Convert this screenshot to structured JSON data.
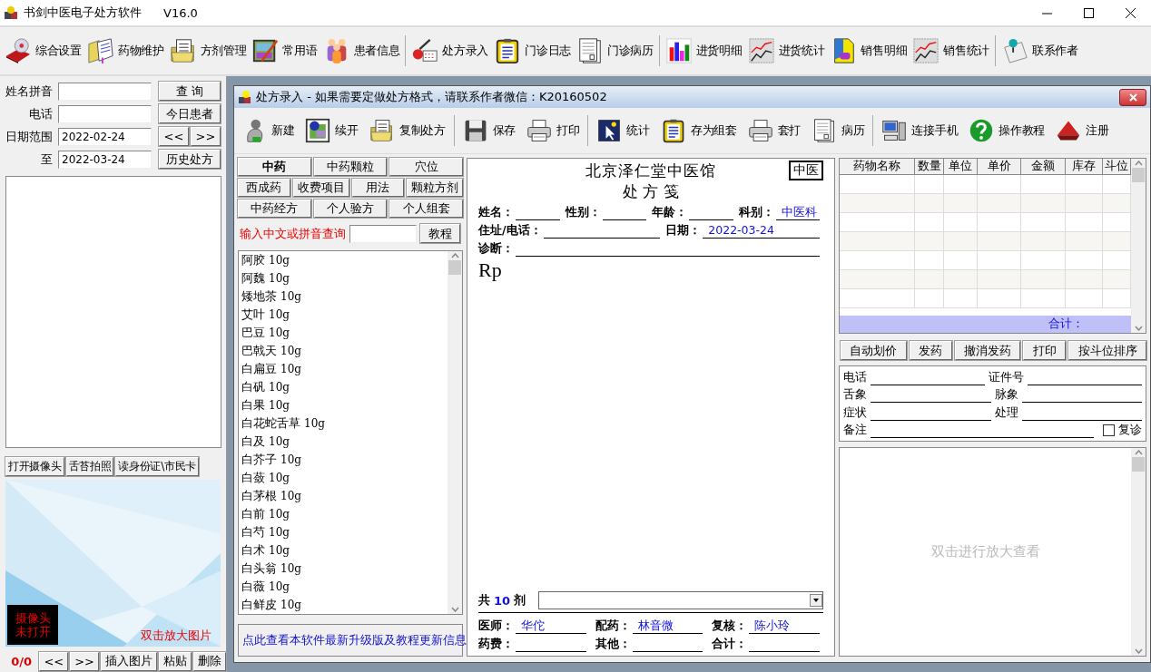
{
  "app": {
    "title": "书剑中医电子处方软件",
    "version": "V16.0"
  },
  "toolbar": {
    "groups": [
      [
        "综合设置",
        "药物维护",
        "方剂管理",
        "常用语",
        "患者信息"
      ],
      [
        "处方录入",
        "门诊日志",
        "门诊病历"
      ],
      [
        "进货明细",
        "进货统计",
        "销售明细",
        "销售统计"
      ],
      [
        "联系作者"
      ]
    ]
  },
  "patient_search": {
    "fields": [
      {
        "label": "姓名拼音",
        "buttons": [
          "查 询"
        ]
      },
      {
        "label": "电话",
        "buttons": [
          "今日患者"
        ]
      },
      {
        "label": "日期范围",
        "value": "2022-02-24",
        "buttons": [
          "<<",
          ">>"
        ]
      },
      {
        "label": "至",
        "value": "2022-03-24",
        "buttons": [
          "历史处方"
        ]
      }
    ]
  },
  "camera": {
    "buttons": [
      "打开摄像头",
      "舌苔拍照",
      "读身份证\\市民卡"
    ],
    "status": [
      "摄像头",
      "未打开"
    ],
    "hint": "双击放大图片"
  },
  "photo_nav": {
    "counter": "0/0",
    "buttons": [
      "<<",
      ">>",
      "插入图片",
      "粘贴",
      "删除"
    ]
  },
  "editor": {
    "title": "处方录入 - 如果需要定做处方格式，请联系作者微信：K20160502",
    "toolbar": {
      "groups": [
        [
          "新建",
          "续开",
          "复制处方"
        ],
        [
          "保存",
          "打印"
        ],
        [
          "统计",
          "存为组套",
          "套打",
          "病历"
        ],
        [
          "连接手机",
          "操作教程",
          "注册"
        ]
      ]
    },
    "categories": [
      [
        {
          "label": "中药",
          "selected": true
        },
        {
          "label": "中药颗粒",
          "selected": false
        },
        {
          "label": "穴位",
          "selected": false
        }
      ],
      [
        {
          "label": "西成药",
          "selected": false
        },
        {
          "label": "收费项目",
          "selected": false
        },
        {
          "label": "用法",
          "selected": false
        },
        {
          "label": "颗粒方剂",
          "selected": false
        }
      ],
      [
        {
          "label": "中药经方",
          "selected": false
        },
        {
          "label": "个人验方",
          "selected": false
        },
        {
          "label": "个人组套",
          "selected": false
        }
      ]
    ],
    "search": {
      "label": "输入中文或拼音查询",
      "button": "教程"
    },
    "medicines": [
      {
        "name": "阿胶",
        "dose": "10g"
      },
      {
        "name": "阿魏",
        "dose": "10g"
      },
      {
        "name": "矮地茶",
        "dose": "10g"
      },
      {
        "name": "艾叶",
        "dose": "10g"
      },
      {
        "name": "巴豆",
        "dose": "10g"
      },
      {
        "name": "巴戟天",
        "dose": "10g"
      },
      {
        "name": "白扁豆",
        "dose": "10g"
      },
      {
        "name": "白矾",
        "dose": "10g"
      },
      {
        "name": "白果",
        "dose": "10g"
      },
      {
        "name": "白花蛇舌草",
        "dose": "10g"
      },
      {
        "name": "白及",
        "dose": "10g"
      },
      {
        "name": "白芥子",
        "dose": "10g"
      },
      {
        "name": "白蔹",
        "dose": "10g"
      },
      {
        "name": "白茅根",
        "dose": "10g"
      },
      {
        "name": "白前",
        "dose": "10g"
      },
      {
        "name": "白芍",
        "dose": "10g"
      },
      {
        "name": "白术",
        "dose": "10g"
      },
      {
        "name": "白头翁",
        "dose": "10g"
      },
      {
        "name": "白薇",
        "dose": "10g"
      },
      {
        "name": "白鲜皮",
        "dose": "10g"
      }
    ],
    "update_link": "点此查看本软件最新升级版及教程更新信息",
    "prescription": {
      "clinic": "北京泽仁堂中医馆",
      "title": "处 方 笺",
      "badge": "中医",
      "rows": [
        [
          {
            "label": "姓名："
          },
          {
            "label": "性别："
          },
          {
            "label": "年龄："
          },
          {
            "label": "科别：",
            "value": "中医科"
          }
        ],
        [
          {
            "label": "住址/电话："
          },
          {
            "label": "日期：",
            "value": "2022-03-24"
          }
        ],
        [
          {
            "label": "诊断："
          }
        ]
      ],
      "rp": "Rp",
      "doses": {
        "prefix": "共",
        "count": "10",
        "unit": "剂"
      },
      "signatures": [
        {
          "label": "医师：",
          "value": "华佗"
        },
        {
          "label": "配药：",
          "value": "林音微"
        },
        {
          "label": "复核：",
          "value": "陈小玲"
        },
        {
          "label": "药费："
        },
        {
          "label": "其他："
        },
        {
          "label": "合计："
        }
      ]
    },
    "items_table": {
      "columns": [
        "药物名称",
        "数量",
        "单位",
        "单价",
        "金额",
        "库存",
        "斗位"
      ],
      "total_label": "合计："
    },
    "actions": [
      "自动划价",
      "发药",
      "撤消发药",
      "打印",
      "按斗位排序"
    ],
    "notes": {
      "rows": [
        [
          {
            "label": "电话"
          },
          {
            "label": "证件号"
          }
        ],
        [
          {
            "label": "舌象"
          },
          {
            "label": "脉象"
          }
        ],
        [
          {
            "label": "症状"
          },
          {
            "label": "处理"
          }
        ],
        [
          {
            "label": "备注"
          }
        ]
      ],
      "checkbox": {
        "label": "复诊",
        "checked": false
      }
    },
    "image_hint": "双击进行放大查看"
  }
}
